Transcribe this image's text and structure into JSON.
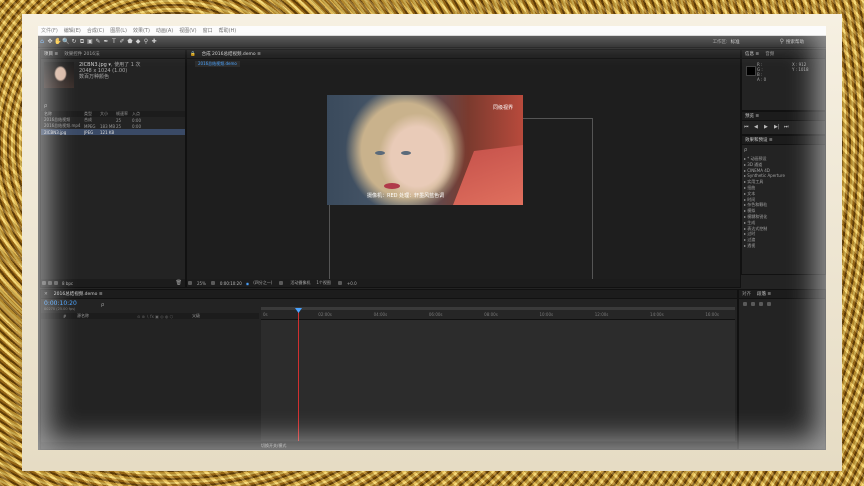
{
  "menu": [
    "文件(F)",
    "编辑(E)",
    "合成(C)",
    "图层(L)",
    "效果(T)",
    "动画(A)",
    "视图(V)",
    "窗口",
    "帮助(H)"
  ],
  "toolbar": {
    "tools": [
      "⌂",
      "✥",
      "✋",
      "🔍",
      "↻",
      "⧉",
      "▣",
      "✎",
      "✒",
      "T",
      "✐",
      "⬟",
      "◆",
      "⚲",
      "✚"
    ],
    "workspace_label": "工作区:",
    "workspace_value": "标准",
    "search_placeholder": "搜索帮助"
  },
  "project": {
    "tab": "项目 ≡",
    "tab2": "效果控件 2016法",
    "selected_name": "2ICBN3.jpg ▾",
    "selected_count": ", 使用了 1 次",
    "selected_dims": "2048 x 1024 (1.00)",
    "selected_desc": "数百万种颜色",
    "search_placeholder": "ρ",
    "columns": [
      "名称",
      "类型",
      "大小",
      "帧速率",
      "入点"
    ],
    "rows": [
      {
        "name": "2016总结视频",
        "type": "合成",
        "size": "",
        "fps": "25",
        "in": "0:00"
      },
      {
        "name": "2016总结视频.mp4",
        "type": "MPEG",
        "size": "183 MB",
        "fps": "25",
        "in": "0:00"
      },
      {
        "name": "2ICBN3.jpg",
        "type": "JPEG",
        "size": "121 KB",
        "fps": "",
        "in": ""
      }
    ],
    "bpc": "8 bpc"
  },
  "viewer": {
    "tab": "合成 2016总结视频.demo ≡",
    "breadcrumb": "2016总结视频.demo",
    "watermark": "同级视界",
    "subtitle": "摄像机：RED  处理：轩墨风蓝色调",
    "zoom": "25%",
    "timecode": "0:00:10:20",
    "quality": "(四分之一)",
    "camera": "活动摄像机",
    "views": "1个视图",
    "offset": "+0.0"
  },
  "info": {
    "tab1": "信息 ≡",
    "tab2": "音频",
    "r": "R :",
    "g": "G :",
    "b": "B :",
    "a": "A : 0",
    "x": "X : 912",
    "y": "Y : 1018"
  },
  "preview": {
    "tab": "预览 ≡",
    "controls": [
      "⏮",
      "◀",
      "▶",
      "▶|",
      "⏭"
    ]
  },
  "effects": {
    "tab": "效果和预设 ≡",
    "search_placeholder": "ρ",
    "items": [
      "* 动画预设",
      "3D 通道",
      "CINEMA 4D",
      "Synthetic Aperture",
      "实用工具",
      "扭曲",
      "文本",
      "时间",
      "杂色和颗粒",
      "模拟",
      "模糊和锐化",
      "生成",
      "表达式控制",
      "过时",
      "过渡",
      "透视"
    ]
  },
  "timeline": {
    "tab": "2016总结视频.demo ≡",
    "timecode": "0:00:10:20",
    "fps_note": "00270 (25.00 fps)",
    "search_placeholder": "ρ",
    "layer_header": [
      "#",
      "源名称"
    ],
    "switch_header": "父级",
    "ruler": [
      "0s",
      "02:00s",
      "04:00s",
      "06:00s",
      "08:00s",
      "10:00s",
      "12:00s",
      "14:00s",
      "16:00s"
    ],
    "bottom_label": "切换开关/模式"
  },
  "paragraph": {
    "tab1": "对齐",
    "tab2": "段落 ≡"
  },
  "colors": {
    "accent": "#4aa3ff",
    "playhead": "#d03030",
    "bg": "#232323"
  }
}
